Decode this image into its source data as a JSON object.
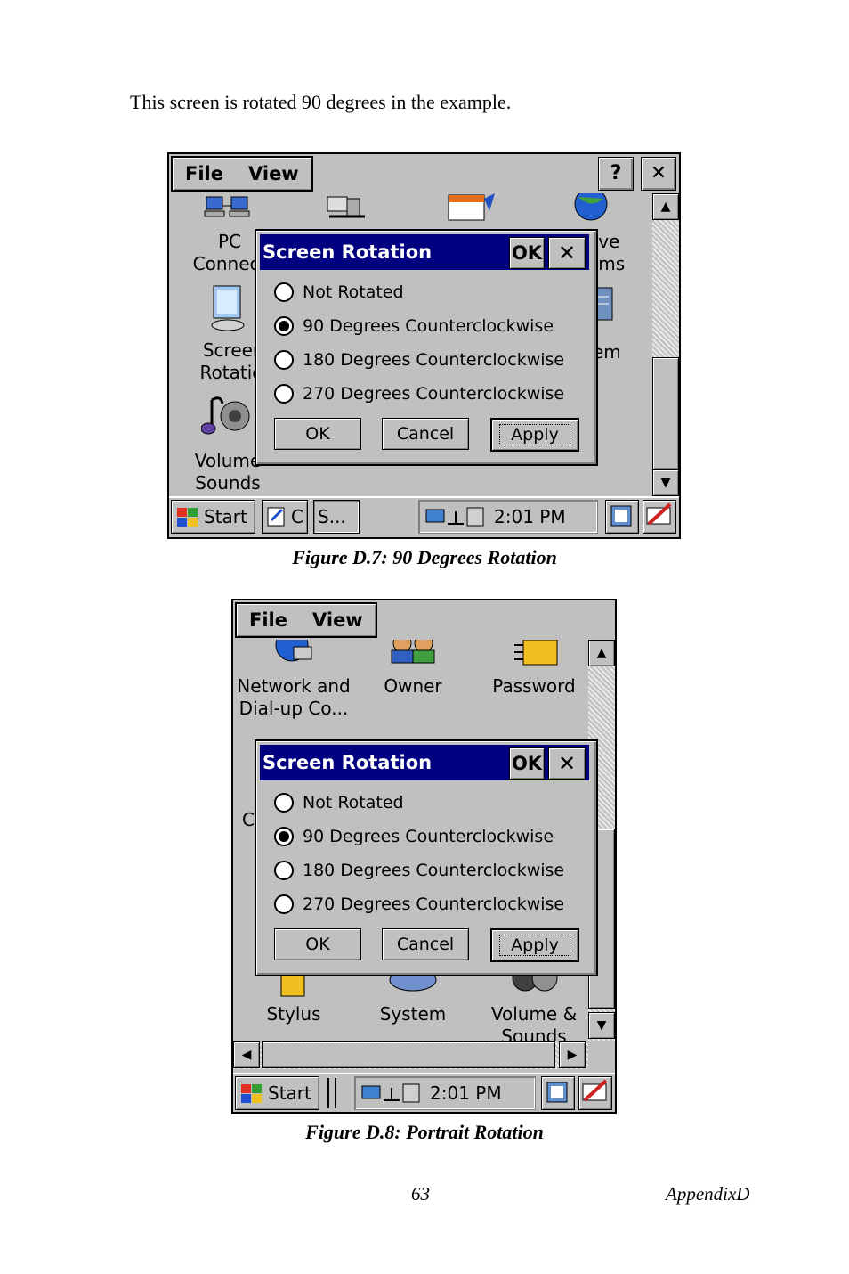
{
  "intro_text": "This screen is rotated 90 degrees in the example.",
  "figure1": {
    "caption": "Figure D.7: 90 Degrees Rotation",
    "menu": [
      "File",
      "View"
    ],
    "help": "?",
    "close": "✕",
    "icons": [
      {
        "label": "PC\nConnect"
      },
      {
        "label": "Screer\nRotatio"
      },
      {
        "label": "Volume\nSounds"
      },
      {
        "label": "ove\nams"
      },
      {
        "label": "em"
      }
    ],
    "taskbar": {
      "start": "Start",
      "task1": "C",
      "task2": "S...",
      "time": "2:01 PM"
    }
  },
  "figure2": {
    "caption": "Figure D.8: Portrait Rotation",
    "menu": [
      "File",
      "View"
    ],
    "icons": [
      {
        "label": "Network and\nDial-up Co..."
      },
      {
        "label": "Owner"
      },
      {
        "label": "Password"
      },
      {
        "label": "C"
      },
      {
        "label": "Stylus"
      },
      {
        "label": "System"
      },
      {
        "label": "Volume &\nSounds"
      }
    ],
    "taskbar": {
      "start": "Start",
      "time": "2:01 PM"
    }
  },
  "dialog": {
    "title": "Screen Rotation",
    "ok_title": "OK",
    "close": "✕",
    "options": [
      "Not Rotated",
      "90 Degrees Counterclockwise",
      "180 Degrees Counterclockwise",
      "270 Degrees Counterclockwise"
    ],
    "selected_index": 1,
    "buttons": {
      "ok": "OK",
      "cancel": "Cancel",
      "apply": "Apply"
    }
  },
  "footer": {
    "page": "63",
    "section": "AppendixD"
  },
  "colors": {
    "titlebar": "#000080",
    "face": "#c0c0c0"
  }
}
